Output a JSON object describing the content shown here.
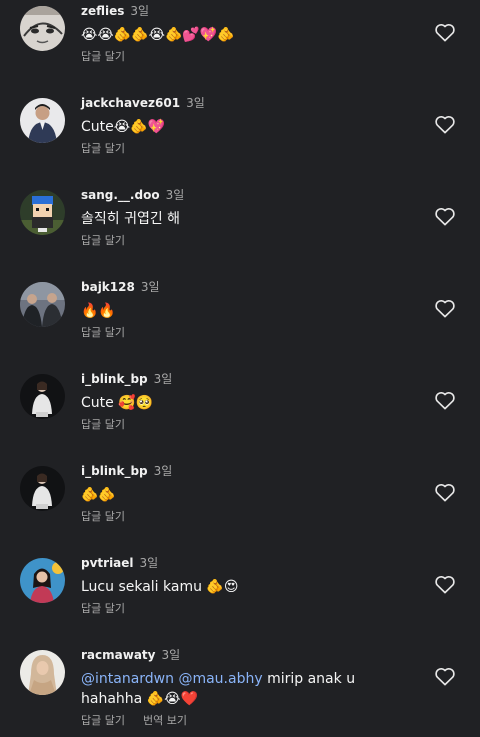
{
  "comments": [
    {
      "username": "zeflies",
      "time": "3일",
      "text": "😭😭🫵🫵😭🫵💕💖🫵",
      "reply_label": "답글 달기",
      "avatar": "sketch-face-avatar"
    },
    {
      "username": "jackchavez601",
      "time": "3일",
      "text": "Cute😭🫵💖",
      "reply_label": "답글 달기",
      "avatar": "man-in-suit-avatar"
    },
    {
      "username": "sang.__.doo",
      "time": "3일",
      "text": "솔직히 귀엽긴 해",
      "reply_label": "답글 달기",
      "avatar": "cartoon-character-avatar"
    },
    {
      "username": "bajk128",
      "time": "3일",
      "text": "🔥🔥",
      "reply_label": "답글 달기",
      "avatar": "group-photo-avatar"
    },
    {
      "username": "i_blink_bp",
      "time": "3일",
      "text": "Cute 🥰🥺",
      "reply_label": "답글 달기",
      "avatar": "person-in-white-avatar"
    },
    {
      "username": "i_blink_bp",
      "time": "3일",
      "text": "🫵🫵",
      "reply_label": "답글 달기",
      "avatar": "person-in-white-avatar"
    },
    {
      "username": "pvtriael",
      "time": "3일",
      "text": "Lucu sekali kamu 🫵😍",
      "reply_label": "답글 달기",
      "avatar": "blue-background-portrait-avatar"
    },
    {
      "username": "racmawaty",
      "time": "3일",
      "mention1": "@intanardwn",
      "mention2": "@mau.abhy",
      "text_rest": " mirip anak u hahahha 🫵😭❤️",
      "reply_label": "답글 달기",
      "translate_label": "번역 보기",
      "avatar": "hijab-woman-avatar"
    }
  ],
  "icons": {
    "like": "heart-outline-icon"
  },
  "colors": {
    "background": "#202124",
    "mention": "#8ab4f8",
    "secondary_text": "#a8a8a8"
  }
}
